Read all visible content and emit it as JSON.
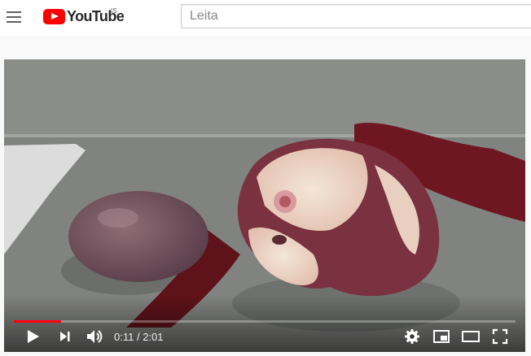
{
  "masthead": {
    "logo_text": "YouTube",
    "country_code": "IS",
    "search": {
      "placeholder": "Leita",
      "value": ""
    }
  },
  "player": {
    "current_time": "0:11",
    "separator": " / ",
    "duration": "2:01",
    "played_fraction": 0.094,
    "loaded_fraction": 0.094,
    "colors": {
      "progress_played": "#ff0000",
      "accent": "#ff0000"
    },
    "icons": [
      "play-icon",
      "next-icon",
      "volume-icon",
      "settings-icon",
      "miniplayer-icon",
      "theater-mode-icon",
      "fullscreen-icon"
    ]
  }
}
